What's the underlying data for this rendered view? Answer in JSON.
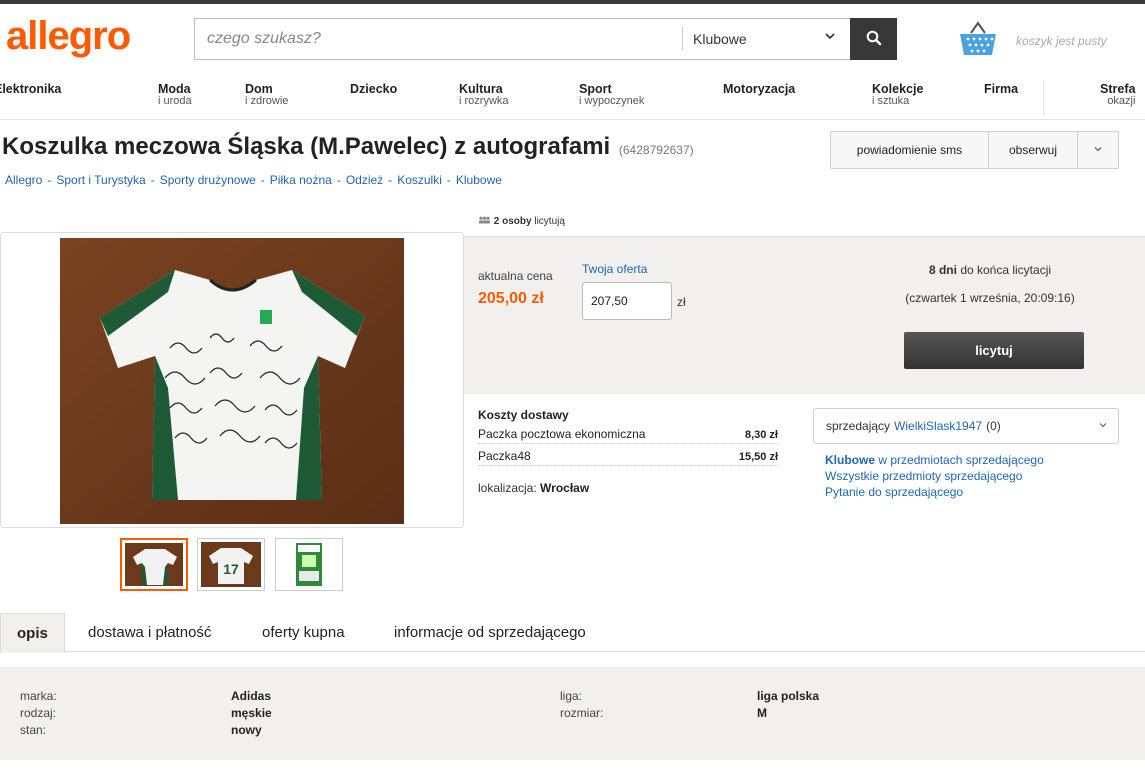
{
  "header": {
    "logo": "allegro",
    "search_placeholder": "czego szukasz?",
    "category_selected": "Klubowe",
    "basket_text": "koszyk jest pusty"
  },
  "categories": [
    {
      "main": "Elektronika",
      "sub": ""
    },
    {
      "main": "Moda",
      "sub": "i uroda"
    },
    {
      "main": "Dom",
      "sub": "i zdrowie"
    },
    {
      "main": "Dziecko",
      "sub": ""
    },
    {
      "main": "Kultura",
      "sub": "i rozrywka"
    },
    {
      "main": "Sport",
      "sub": "i wypoczynek"
    },
    {
      "main": "Motoryzacja",
      "sub": ""
    },
    {
      "main": "Kolekcje",
      "sub": "i sztuka"
    },
    {
      "main": "Firma",
      "sub": ""
    },
    {
      "main": "Strefa",
      "sub": "okazji"
    }
  ],
  "offer": {
    "title": "Koszulka meczowa Śląska (M.Pawelec) z autografami",
    "id": "(6428792637)",
    "sms_label": "powiadomienie sms",
    "watch_label": "obserwuj"
  },
  "breadcrumbs": [
    "Allegro",
    "Sport i Turystyka",
    "Sporty drużynowe",
    "Piłka nożna",
    "Odzież",
    "Koszulki",
    "Klubowe"
  ],
  "bidding": {
    "bidders_count": "2 osoby",
    "bidders_suffix": "licytują",
    "current_price_label": "aktualna cena",
    "current_price": "205,00 zł",
    "your_offer_label": "Twoja oferta",
    "your_offer_value": "207,50",
    "currency": "zł",
    "days_left": "8 dni",
    "days_left_suffix": "do końca licytacji",
    "end_date": "(czwartek 1 września, 20:09:16)",
    "bid_button": "licytuj"
  },
  "shipping": {
    "title": "Koszty dostawy",
    "options": [
      {
        "name": "Paczka pocztowa ekonomiczna",
        "cost": "8,30 zł"
      },
      {
        "name": "Paczka48",
        "cost": "15,50 zł"
      }
    ],
    "location_label": "lokalizacja:",
    "location_value": "Wrocław"
  },
  "seller": {
    "prefix": "sprzedający",
    "name": "WielkiSlask1947",
    "rating": "(0)",
    "links": {
      "category_bold": "Klubowe",
      "category_rest": "w przedmiotach sprzedającego",
      "all_items": "Wszystkie przedmioty sprzedającego",
      "ask": "Pytanie do sprzedającego"
    }
  },
  "tabs": [
    "opis",
    "dostawa i płatność",
    "oferty kupna",
    "informacje od sprzedającego"
  ],
  "params": {
    "left": [
      {
        "label": "marka:",
        "value": "Adidas"
      },
      {
        "label": "rodzaj:",
        "value": "męskie"
      },
      {
        "label": "stan:",
        "value": "nowy"
      }
    ],
    "right": [
      {
        "label": "liga:",
        "value": "liga polska"
      },
      {
        "label": "rozmiar:",
        "value": "M"
      }
    ]
  },
  "colors": {
    "brand": "#ff5a00",
    "link": "#1e67b0",
    "panel": "#f1f0ef",
    "button_dark": "#383838"
  },
  "icons": [
    "search-icon",
    "basket-icon",
    "chevron-down-icon",
    "bidders-icon"
  ]
}
